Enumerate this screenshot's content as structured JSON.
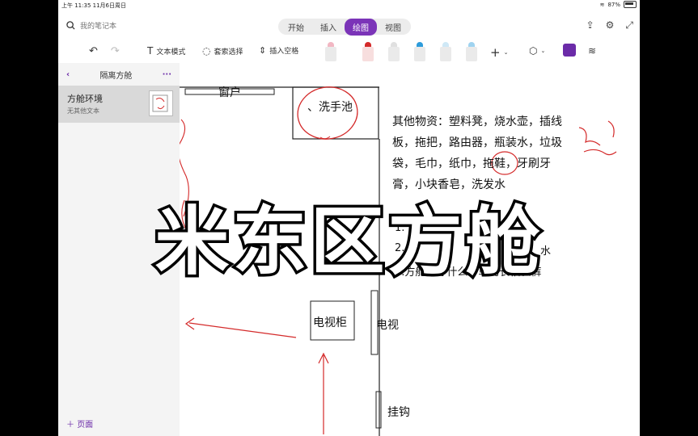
{
  "status": {
    "time_date": "上午 11:35  11月6日周日",
    "battery": "87%"
  },
  "header": {
    "search_placeholder": "我的笔记本",
    "tabs": [
      "开始",
      "插入",
      "绘图",
      "视图"
    ],
    "active_tab": "绘图"
  },
  "toolbar": {
    "text_mode": "文本模式",
    "lasso_select": "套索选择",
    "insert_space": "插入空格"
  },
  "sidebar": {
    "section_title": "隔离方舱",
    "pages": [
      {
        "title": "方舱环境",
        "subtitle": "无其他文本"
      }
    ],
    "add_page": "页面"
  },
  "canvas": {
    "label_window": "窗户",
    "label_sink": "、洗手池",
    "label_tv_cabinet": "电视柜",
    "label_tv": "电视",
    "label_hook": "挂钩",
    "notes_line1": "其他物资：塑料凳，烧水壶，插线",
    "notes_line2": "板，拖把，路由器，瓶装水，垃圾",
    "notes_line3": "袋，毛巾，纸巾，拖鞋，牙刷牙",
    "notes_line4": "膏，小块香皂，洗发水",
    "list_1": "1.",
    "list_2": "2.",
    "list_2_tail": "水",
    "list_3": "3.方舱内穿什么：单的长袖长裤",
    "handwriting_red": "脸盆"
  },
  "overlay_title": "米东区方舱",
  "colors": {
    "accent": "#7b34b8",
    "ink_red": "#d42a2a"
  }
}
